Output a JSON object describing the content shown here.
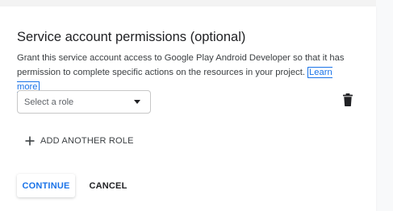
{
  "section": {
    "title": "Service account permissions (optional)",
    "description": "Grant this service account access to Google Play Android Developer so that it has permission to complete specific actions on the resources in your project.",
    "learn_more": "Learn more"
  },
  "role": {
    "placeholder": "Select a role",
    "caret_icon": "arrow-drop-down-icon",
    "delete_icon": "trash-icon"
  },
  "add_role": {
    "label": "ADD ANOTHER ROLE",
    "icon": "plus-icon"
  },
  "actions": {
    "continue_label": "CONTINUE",
    "cancel_label": "CANCEL"
  },
  "colors": {
    "accent": "#1a73e8",
    "text": "#202124",
    "secondary_text": "#5f6368",
    "border": "#c7c7c7"
  }
}
